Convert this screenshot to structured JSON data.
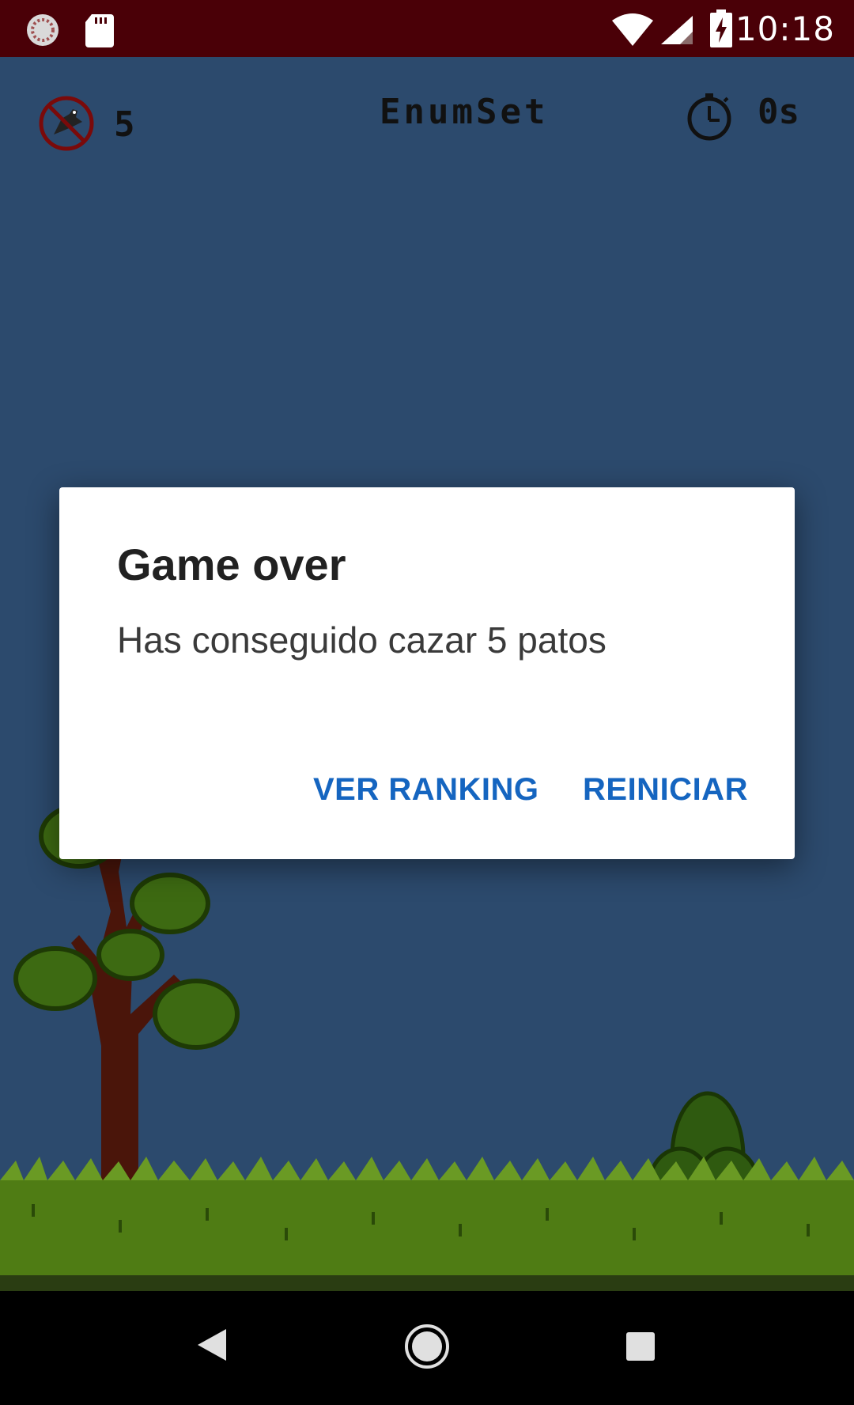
{
  "status_bar": {
    "time": "10:18",
    "icons": [
      "sync-icon",
      "sd-card-icon",
      "wifi-icon",
      "signal-icon",
      "battery-charging-icon"
    ]
  },
  "hud": {
    "ducks_count": "5",
    "title": "EnumSet",
    "timer": "0s",
    "icons": [
      "no-duck-icon",
      "stopwatch-icon"
    ]
  },
  "dialog": {
    "title": "Game over",
    "message": "Has conseguido cazar 5 patos",
    "buttons": {
      "ranking": "VER RANKING",
      "restart": "REINICIAR"
    }
  },
  "nav_bar": {
    "icons": [
      "back-icon",
      "home-icon",
      "recents-icon"
    ]
  },
  "colors": {
    "status_bar": "#4a0007",
    "sky": "#2c4a6d",
    "button_text": "#1565c0",
    "grass": "#5a8a1a",
    "tree_trunk": "#5a1a0a",
    "foliage": "#3e7a1a"
  }
}
